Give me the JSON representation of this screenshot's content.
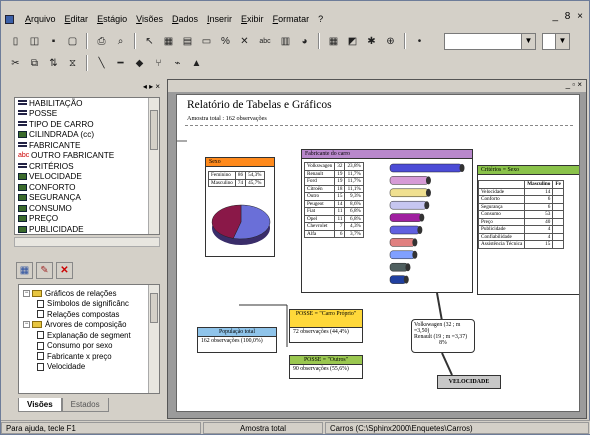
{
  "menu": [
    "Arquivo",
    "Editar",
    "Estágio",
    "Visões",
    "Dados",
    "Inserir",
    "Exibir",
    "Formatar",
    "?"
  ],
  "window_controls": "_ 8 ×",
  "toolbar1": [
    "new-icon",
    "open-icon",
    "save-icon",
    "print-preview-icon",
    "print-icon",
    "zoom-icon",
    "pointer-icon",
    "grid-icon",
    "table-icon",
    "comment-icon",
    "percent-icon",
    "delete-icon",
    "abc-icon",
    "chart-icon",
    "pie-icon",
    "layout-icon",
    "properties-icon",
    "tools-icon"
  ],
  "toolbar2": [
    "cut-icon",
    "copy-icon",
    "sort-icon",
    "filter-icon",
    "line-icon",
    "arrow-icon",
    "plus-icon",
    "branch-icon",
    "level-icon",
    "color-icon"
  ],
  "variables": [
    {
      "name": "HABILITAÇÃO",
      "kind": "cat"
    },
    {
      "name": "POSSE",
      "kind": "cat"
    },
    {
      "name": "TIPO DE CARRO",
      "kind": "cat"
    },
    {
      "name": "CILINDRADA (cc)",
      "kind": "num"
    },
    {
      "name": "FABRICANTE",
      "kind": "cat"
    },
    {
      "name": "OUTRO FABRICANTE",
      "kind": "txt"
    },
    {
      "name": "CRITÉRIOS",
      "kind": "cat"
    },
    {
      "name": "VELOCIDADE",
      "kind": "num"
    },
    {
      "name": "CONFORTO",
      "kind": "num"
    },
    {
      "name": "SEGURANÇA",
      "kind": "num"
    },
    {
      "name": "CONSUMO",
      "kind": "num"
    },
    {
      "name": "PREÇO",
      "kind": "num"
    },
    {
      "name": "PUBLICIDADE",
      "kind": "num"
    }
  ],
  "tree": [
    {
      "label": "Gráficos de relações",
      "type": "folder",
      "indent": 0
    },
    {
      "label": "Símbolos de significânc",
      "type": "doc",
      "indent": 1
    },
    {
      "label": "Relações compostas",
      "type": "doc",
      "indent": 1
    },
    {
      "label": "Árvores de composição",
      "type": "folder",
      "indent": 0
    },
    {
      "label": "Explanação de segment",
      "type": "doc",
      "indent": 1
    },
    {
      "label": "Consumo por sexo",
      "type": "doc",
      "indent": 1
    },
    {
      "label": "Fabricante x preço",
      "type": "doc",
      "indent": 1
    },
    {
      "label": "Velocidade",
      "type": "doc",
      "indent": 1
    }
  ],
  "tabs": [
    "Visões",
    "Estados"
  ],
  "page": {
    "title": "Relatório de Tabelas e Gráficos",
    "subtitle": "Amostra total : 162 observações",
    "sexo": {
      "header": "Sexo",
      "rows": [
        [
          "Feminino",
          "86",
          "54,3%"
        ],
        [
          "Masculino",
          "74",
          "45,7%"
        ]
      ],
      "pie": [
        54.3,
        45.7
      ]
    },
    "fabricante": {
      "header": "Fabricante do carro",
      "rows": [
        [
          "Volkswagen",
          "32",
          "23,8%"
        ],
        [
          "Renault",
          "19",
          "11,7%"
        ],
        [
          "Ford",
          "19",
          "11,7%"
        ],
        [
          "Citroën",
          "18",
          "11,1%"
        ],
        [
          "Outro",
          "15",
          "9,3%"
        ],
        [
          "Peugeot",
          "14",
          "8,6%"
        ],
        [
          "Fiat",
          "11",
          "6,8%"
        ],
        [
          "Opel",
          "11",
          "6,8%"
        ],
        [
          "Chevrolet",
          "7",
          "4,3%"
        ],
        [
          "Alfa",
          "6",
          "3,7%"
        ]
      ],
      "bar_values": [
        23.8,
        11.7,
        11.7,
        11.1,
        9.3,
        8.6,
        6.8,
        6.8,
        4.3,
        3.7
      ]
    },
    "criterio": {
      "header": "Critérios = Sexo",
      "cols": [
        "",
        "Masculino",
        "Fe"
      ],
      "rows": [
        [
          "Velocidade",
          "14",
          ""
        ],
        [
          "Conforto",
          "6",
          ""
        ],
        [
          "Segurança",
          "6",
          ""
        ],
        [
          "Consumo",
          "53",
          ""
        ],
        [
          "Preço",
          "40",
          ""
        ],
        [
          "Publicidade",
          "4",
          ""
        ],
        [
          "Confiabilidade",
          "4",
          ""
        ],
        [
          "Assistência Técnica",
          "15",
          ""
        ]
      ]
    },
    "pop": {
      "header": "População total",
      "text": "162 observações (100,0%)"
    },
    "posse1": {
      "header": "POSSE = \"Carro Próprio\"",
      "text": "72 observações (44,4%)"
    },
    "posse2": {
      "header": "POSSE = \"Outros\"",
      "text": "90 observações (55,6%)"
    },
    "vel": {
      "lines": [
        "Volkswagen (32 ; m =3,50)",
        "Renault (19 ; m =3,37)",
        "8%"
      ]
    },
    "veloc_label": "VELOCIDADE"
  },
  "status": [
    "Para ajuda, tecle F1",
    "Amostra total",
    "Carros (C:\\Sphinx2000\\Enquetes\\Carros)"
  ],
  "colors": {
    "pie_a": "#6a6fd8",
    "pie_b": "#8a1848",
    "sexo_header": "#ff8a1c",
    "fab_header": "#b988cc",
    "crit_header": "#8ac24a"
  }
}
